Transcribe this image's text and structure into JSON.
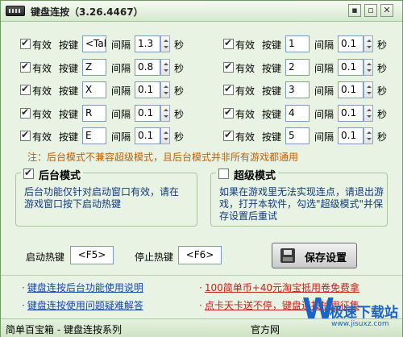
{
  "window": {
    "title": "键盘连按（3.26.4467）",
    "minimize": "▪",
    "maximize": "▫",
    "close": "✕"
  },
  "labels": {
    "enabled": "有效",
    "key": "按键",
    "interval": "间隔",
    "seconds": "秒"
  },
  "left_rows": [
    {
      "checked": true,
      "key": "<Tab",
      "interval": "1.3"
    },
    {
      "checked": true,
      "key": "Z",
      "interval": "0.8"
    },
    {
      "checked": true,
      "key": "X",
      "interval": "0.1"
    },
    {
      "checked": true,
      "key": "R",
      "interval": "0.1"
    },
    {
      "checked": true,
      "key": "E",
      "interval": "0.1"
    }
  ],
  "right_rows": [
    {
      "checked": true,
      "key": "1",
      "interval": "0.1"
    },
    {
      "checked": true,
      "key": "2",
      "interval": "0.1"
    },
    {
      "checked": true,
      "key": "3",
      "interval": "0.1"
    },
    {
      "checked": true,
      "key": "4",
      "interval": "0.1"
    },
    {
      "checked": true,
      "key": "5",
      "interval": "0.1"
    }
  ],
  "note": "注：后台模式不兼容超级模式，且后台模式并非所有游戏都通用",
  "background_mode": {
    "checked": true,
    "title": "后台模式",
    "desc_line1": "后台功能仅针对启动窗口有效，请在",
    "desc_line2": "游戏窗口按下启动热键"
  },
  "super_mode": {
    "checked": false,
    "title": "超级模式",
    "desc_line1": "如果在游戏里无法实现连点，请退出游",
    "desc_line2": "戏，打开本软件，勾选\"超级模式\"并保",
    "desc_line3": "存设置后重试"
  },
  "hotkeys": {
    "start_label": "启动热键",
    "start_value": "<F5>",
    "stop_label": "停止热键",
    "stop_value": "<F6>"
  },
  "save_button": "保存设置",
  "links": {
    "left1": "键盘连按后台功能使用说明",
    "left2": "键盘连按使用问题疑难解答",
    "right1": "100简单币+40元淘宝抵用卷免费拿",
    "right2": "点卡天卡送不停，键盘连按抽用征集"
  },
  "status": {
    "left": "简单百宝箱 - 键盘连按系列",
    "right": "官方网"
  },
  "watermark": {
    "logo": "W",
    "text": "极速下载站",
    "sub": "www.jisuxz.com"
  },
  "colors": {
    "accent_red": "#c8201a",
    "link_blue": "#1848a8",
    "note_orange": "#c06000"
  }
}
